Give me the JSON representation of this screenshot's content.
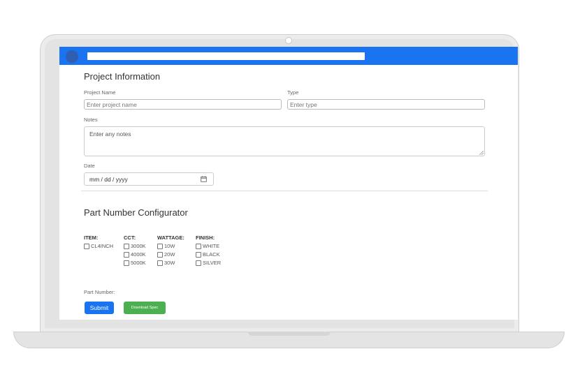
{
  "colors": {
    "appbar": "#1a73f0",
    "avatar": "#2f5fb3",
    "submit": "#1a73f0",
    "download": "#4caf50"
  },
  "project": {
    "title": "Project Information",
    "project_name_label": "Project Name",
    "project_name_placeholder": "Enter project name",
    "type_label": "Type",
    "type_placeholder": "Enter type",
    "notes_label": "Notes",
    "notes_placeholder": "Enter any notes",
    "date_label": "Date",
    "date_placeholder": "mm / dd / yyyy"
  },
  "configurator": {
    "title": "Part Number Configurator",
    "columns": [
      {
        "header": "ITEM:",
        "options": [
          "CL4INCH"
        ]
      },
      {
        "header": "CCT:",
        "options": [
          "3000K",
          "4000K",
          "5000K"
        ]
      },
      {
        "header": "WATTAGE:",
        "options": [
          "10W",
          "20W",
          "30W"
        ]
      },
      {
        "header": "FINISH:",
        "options": [
          "WHITE",
          "BLACK",
          "SILVER"
        ]
      }
    ],
    "part_number_label": "Part Number:"
  },
  "actions": {
    "submit_label": "Submit",
    "download_label": "Download Spec"
  },
  "icons": {
    "calendar": "calendar-icon",
    "resize": "resize-grip-icon",
    "avatar": "avatar"
  }
}
